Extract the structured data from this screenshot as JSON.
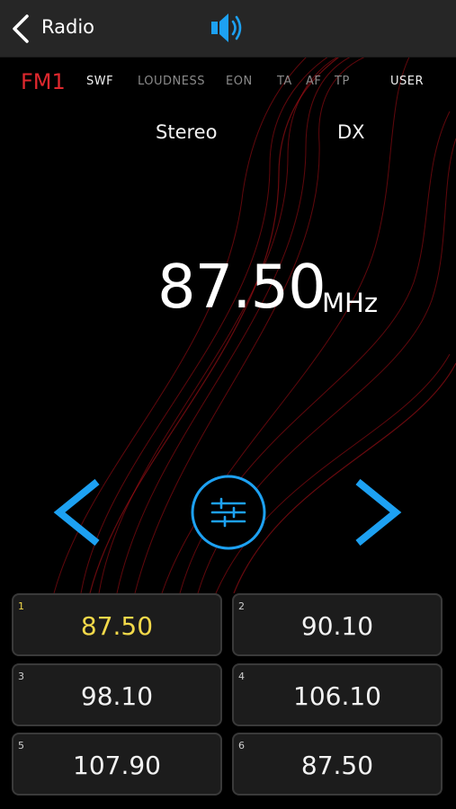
{
  "header": {
    "title": "Radio",
    "back_icon": "chevron-left-icon",
    "volume_icon": "speaker-icon"
  },
  "options": {
    "band": "FM1",
    "swf": "SWF",
    "loudness": "LOUDNESS",
    "eon": "EON",
    "ta": "TA",
    "af": "AF",
    "tp": "TP",
    "user": "USER"
  },
  "status": {
    "stereo": "Stereo",
    "dx": "DX"
  },
  "tuner": {
    "frequency": "87.50",
    "unit": "MHz"
  },
  "controls": {
    "prev_icon": "chevron-left-icon",
    "eq_icon": "equalizer-sliders-icon",
    "next_icon": "chevron-right-icon"
  },
  "presets": [
    {
      "num": "1",
      "value": "87.50",
      "active": true
    },
    {
      "num": "2",
      "value": "90.10",
      "active": false
    },
    {
      "num": "3",
      "value": "98.10",
      "active": false
    },
    {
      "num": "4",
      "value": "106.10",
      "active": false
    },
    {
      "num": "5",
      "value": "107.90",
      "active": false
    },
    {
      "num": "6",
      "value": "87.50",
      "active": false
    }
  ],
  "colors": {
    "accent": "#1da1f2",
    "band": "#e0282e",
    "active_preset": "#f3d94a",
    "topbar": "#262626"
  }
}
